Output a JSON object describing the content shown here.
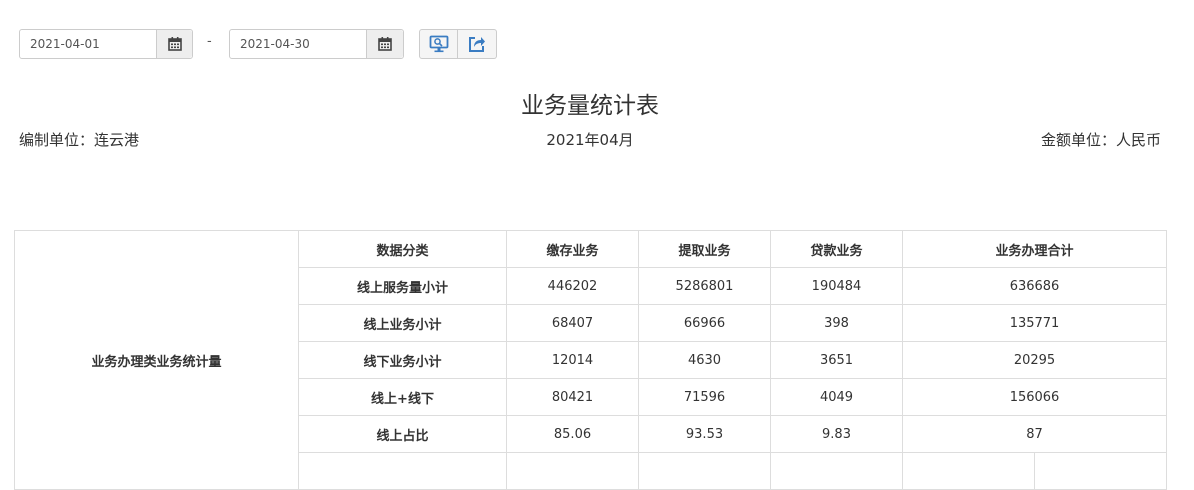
{
  "filters": {
    "start_date": "2021-04-01",
    "end_date": "2021-04-30",
    "separator": "-"
  },
  "icons": {
    "calendar": "calendar-icon",
    "preview": "monitor-preview-icon",
    "export": "share-export-icon",
    "accent_color": "#3a7cc2"
  },
  "report": {
    "title": "业务量统计表",
    "org": "编制单位：连云港",
    "period": "2021年04月",
    "currency": "金额单位：人民币"
  },
  "table": {
    "section_label": "业务办理类业务统计量",
    "headers": [
      "数据分类",
      "缴存业务",
      "提取业务",
      "贷款业务",
      "业务办理合计"
    ],
    "rows": [
      {
        "label": "线上服务量小计",
        "values": [
          "446202",
          "5286801",
          "190484",
          "636686"
        ]
      },
      {
        "label": "线上业务小计",
        "values": [
          "68407",
          "66966",
          "398",
          "135771"
        ]
      },
      {
        "label": "线下业务小计",
        "values": [
          "12014",
          "4630",
          "3651",
          "20295"
        ]
      },
      {
        "label": "线上+线下",
        "values": [
          "80421",
          "71596",
          "4049",
          "156066"
        ]
      },
      {
        "label": "线上占比",
        "values": [
          "85.06",
          "93.53",
          "9.83",
          "87"
        ]
      }
    ]
  }
}
